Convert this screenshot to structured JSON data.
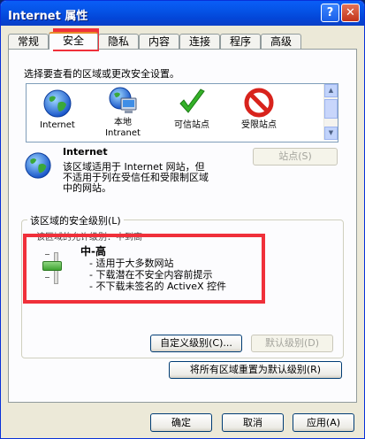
{
  "window": {
    "title": "Internet 属性",
    "help_label": "?",
    "close_label": "✕"
  },
  "tabs": [
    {
      "label": "常规"
    },
    {
      "label": "安全"
    },
    {
      "label": "隐私"
    },
    {
      "label": "内容"
    },
    {
      "label": "连接"
    },
    {
      "label": "程序"
    },
    {
      "label": "高级"
    }
  ],
  "security": {
    "instruction": "选择要查看的区域或更改安全设置。",
    "zones": [
      {
        "label": "Internet",
        "icon": "globe-icon"
      },
      {
        "label": "本地\nIntranet",
        "icon": "computer-globe-icon"
      },
      {
        "label": "可信站点",
        "icon": "checkmark-icon"
      },
      {
        "label": "受限站点",
        "icon": "forbidden-icon"
      }
    ],
    "selected_zone": {
      "name": "Internet",
      "description_lines": [
        "该区域适用于 Internet 网站，但",
        "不适用于列在受信任和受限制区域",
        "中的网站。"
      ],
      "sites_button": "站点(S)"
    },
    "level_group": {
      "title": "该区域的安全级别(L)",
      "obscured_line": "该区域的允许级别：中到高",
      "level_name": "中-高",
      "bullets": [
        "- 适用于大多数网站",
        "- 下载潜在不安全内容前提示",
        "- 不下载未签名的 ActiveX 控件"
      ],
      "custom_button": "自定义级别(C)...",
      "default_button": "默认级别(D)"
    },
    "reset_all_button": "将所有区域重置为默认级别(R)"
  },
  "footer": {
    "ok": "确定",
    "cancel": "取消",
    "apply": "应用(A)"
  },
  "colors": {
    "titlebar": "#0553e6",
    "highlight_box": "#f0303a",
    "tab_active_border": "#e68b2c"
  }
}
